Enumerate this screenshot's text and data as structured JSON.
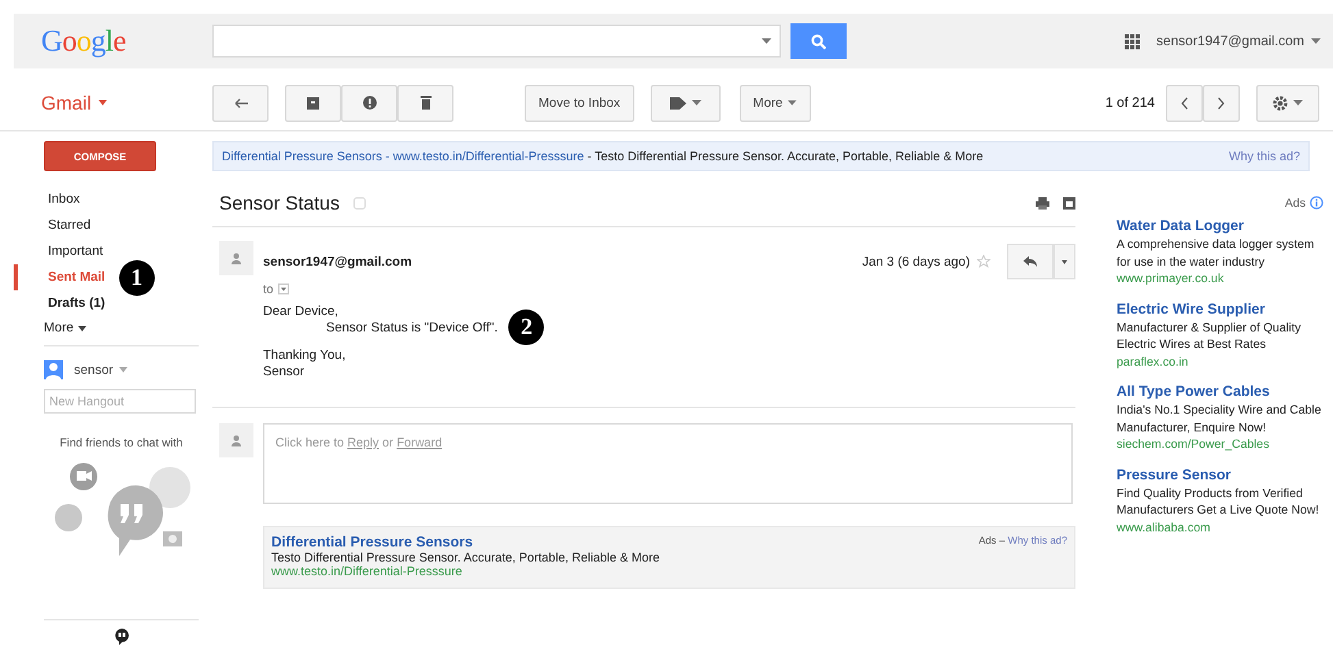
{
  "header": {
    "logo": "Google",
    "account": "sensor1947@gmail.com"
  },
  "toolbar": {
    "app_label": "Gmail",
    "text_buttons": [
      "Move to Inbox",
      "More"
    ],
    "pager": "1 of 214"
  },
  "compose": "COMPOSE",
  "top_ad": {
    "link": "Differential Pressure Sensors - www.testo.in/Differential-Presssure",
    "text": "- Testo Differential Pressure Sensor. Accurate, Portable, Reliable & More",
    "why": "Why this ad?"
  },
  "sidebar": {
    "items": [
      {
        "label": "Inbox",
        "selected": false,
        "unread": false
      },
      {
        "label": "Starred",
        "selected": false,
        "unread": false
      },
      {
        "label": "Important",
        "selected": false,
        "unread": false
      },
      {
        "label": "Sent Mail",
        "selected": true,
        "unread": false,
        "callout": "1"
      },
      {
        "label": "Drafts (1)",
        "selected": false,
        "unread": true
      }
    ],
    "more": "More",
    "hangouts": {
      "user": "sensor",
      "placeholder": "New Hangout",
      "prompt": "Find friends to chat with"
    }
  },
  "thread": {
    "subject": "Sensor Status",
    "message": {
      "sender": "sensor1947@gmail.com",
      "to": "to",
      "date": "Jan 3 (6 days ago)",
      "starred": false,
      "paragraphs": [
        [
          {
            "text": "Dear Device,",
            "indent": false
          },
          {
            "text": "Sensor Status is \"Device Off\".",
            "indent": true,
            "callout": "2"
          }
        ],
        [
          {
            "text": "Thanking You,",
            "indent": false
          },
          {
            "text": "Sensor",
            "indent": false
          }
        ]
      ]
    },
    "reply": {
      "prefix": "Click here to",
      "reply": "Reply",
      "conjunction": "or",
      "forward": "Forward"
    },
    "ad": {
      "title": "Differential Pressure Sensors",
      "text": "Testo Differential Pressure Sensor. Accurate, Portable, Reliable & More",
      "url": "www.testo.in/Differential-Presssure",
      "label": "Ads –",
      "why": "Why this ad?"
    }
  },
  "side_ads": {
    "label": "Ads",
    "items": [
      {
        "title": "Water Data Logger",
        "text": "A comprehensive data logger system for use in the water industry",
        "url": "www.primayer.co.uk"
      },
      {
        "title": "Electric Wire Supplier",
        "text": "Manufacturer & Supplier of Quality Electric Wires at Best Rates",
        "url": "paraflex.co.in"
      },
      {
        "title": "All Type Power Cables",
        "text": "India's No.1 Speciality Wire and Cable Manufacturer, Enquire Now!",
        "url": "siechem.com/Power_Cables"
      },
      {
        "title": "Pressure Sensor",
        "text": "Find Quality Products from Verified Manufacturers Get a Live Quote Now!",
        "url": "www.alibaba.com"
      }
    ]
  }
}
